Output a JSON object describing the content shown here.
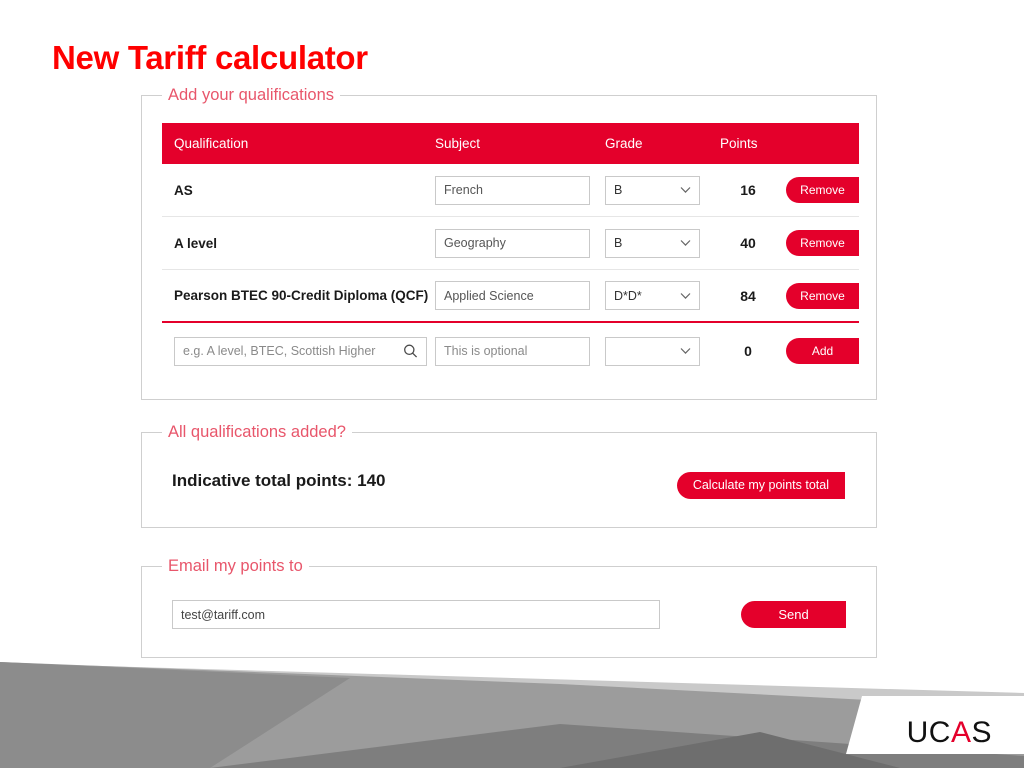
{
  "slide": {
    "title": "New Tariff calculator"
  },
  "qualifications_panel": {
    "legend": "Add your qualifications",
    "columns": {
      "qualification": "Qualification",
      "subject": "Subject",
      "grade": "Grade",
      "points": "Points"
    },
    "rows": [
      {
        "qualification": "AS",
        "subject": "French",
        "grade": "B",
        "points": "16",
        "action_label": "Remove"
      },
      {
        "qualification": "A level",
        "subject": "Geography",
        "grade": "B",
        "points": "40",
        "action_label": "Remove"
      },
      {
        "qualification": "Pearson BTEC 90-Credit Diploma (QCF)",
        "subject": "Applied Science",
        "grade": "D*D*",
        "points": "84",
        "action_label": "Remove"
      }
    ],
    "add_row": {
      "qualification_placeholder": "e.g. A level, BTEC, Scottish Higher",
      "qualification_value": "",
      "subject_placeholder": "This is optional",
      "subject_value": "",
      "grade": "",
      "points": "0",
      "action_label": "Add",
      "search_icon": "search-icon",
      "dropdown_icon": "chevron-down-icon"
    }
  },
  "totals_panel": {
    "legend": "All qualifications added?",
    "total_text": "Indicative total points: 140",
    "total_label": "Indicative total points:",
    "total_value": "140",
    "calculate_label": "Calculate my points total"
  },
  "email_panel": {
    "legend": "Email my points to",
    "email_value": "test@tariff.com",
    "email_placeholder": "",
    "send_label": "Send"
  },
  "branding": {
    "logo_part1": "UC",
    "logo_accent": "A",
    "logo_part2": "S"
  },
  "colors": {
    "brand_red": "#E4002B",
    "title_red": "#FF0000",
    "legend_red": "#E8566B",
    "panel_border": "#CFCFCF",
    "input_border": "#C9C9C9",
    "footer_grey_light": "#C8C8C8",
    "footer_grey_mid": "#9A9A9A",
    "footer_grey_dark": "#7D7D7D"
  }
}
